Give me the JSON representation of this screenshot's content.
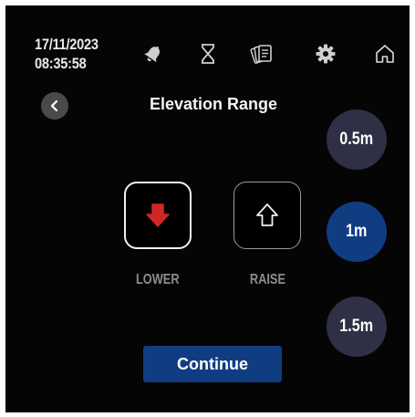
{
  "header": {
    "date": "17/11/2023",
    "time": "08:35:58",
    "icons": [
      "bell-icon",
      "hourglass-icon",
      "documents-icon",
      "gear-icon",
      "home-icon"
    ]
  },
  "page": {
    "title": "Elevation Range",
    "back_icon": "chevron-left-icon"
  },
  "range_options": [
    {
      "label": "0.5m",
      "selected": false
    },
    {
      "label": "1m",
      "selected": true
    },
    {
      "label": "1.5m",
      "selected": false
    }
  ],
  "direction": {
    "lower_label": "LOWER",
    "raise_label": "RAISE",
    "lower_icon": "arrow-down-icon",
    "raise_icon": "arrow-up-outline-icon",
    "active": "lower"
  },
  "colors": {
    "background": "#050505",
    "accent": "#103d82",
    "range_default": "#2f2f46",
    "lower_arrow": "#d12626"
  },
  "continue_label": "Continue"
}
